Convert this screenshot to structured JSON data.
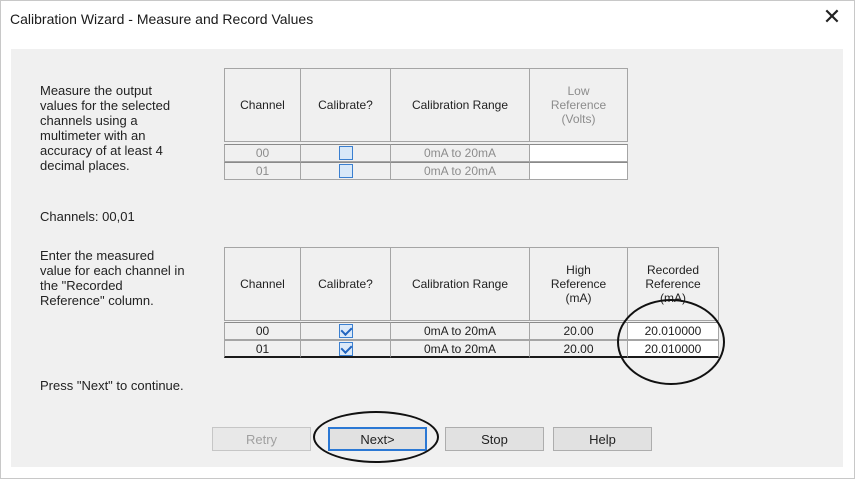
{
  "window": {
    "title": "Calibration Wizard - Measure and Record Values",
    "close_glyph": "✕"
  },
  "instructions": {
    "measure_lines": [
      "Measure the output",
      "values for the selected",
      "channels using a",
      "multimeter with an",
      "accuracy of at least 4",
      "decimal  places."
    ],
    "channels_text": "Channels: 00,01",
    "enter_lines": [
      "Enter the measured",
      "value for each channel in",
      "the \"Recorded",
      "Reference\" column."
    ],
    "press_next": "Press \"Next\" to continue."
  },
  "table_low": {
    "headers": [
      "Channel",
      "Calibrate?",
      "Calibration Range",
      [
        "Low",
        "Reference",
        "(Volts)"
      ]
    ],
    "rows": [
      {
        "channel": "00",
        "calibrate": false,
        "range": "0mA to 20mA",
        "low_ref": ""
      },
      {
        "channel": "01",
        "calibrate": false,
        "range": "0mA to 20mA",
        "low_ref": ""
      }
    ]
  },
  "table_high": {
    "headers": [
      "Channel",
      "Calibrate?",
      "Calibration Range",
      [
        "High",
        "Reference",
        "(mA)"
      ],
      [
        "Recorded",
        "Reference",
        "(mA)"
      ]
    ],
    "rows": [
      {
        "channel": "00",
        "calibrate": true,
        "range": "0mA to 20mA",
        "high_ref": "20.00",
        "recorded": "20.010000"
      },
      {
        "channel": "01",
        "calibrate": true,
        "range": "0mA to 20mA",
        "high_ref": "20.00",
        "recorded": "20.010000"
      }
    ]
  },
  "buttons": {
    "retry": "Retry",
    "next": "Next>",
    "stop": "Stop",
    "help": "Help"
  },
  "colors": {
    "checkbox_border": "#3a7fd0",
    "check_mark": "#2265c0",
    "default_button_border": "#2b78d4",
    "annotation_ellipse": "#111111"
  }
}
